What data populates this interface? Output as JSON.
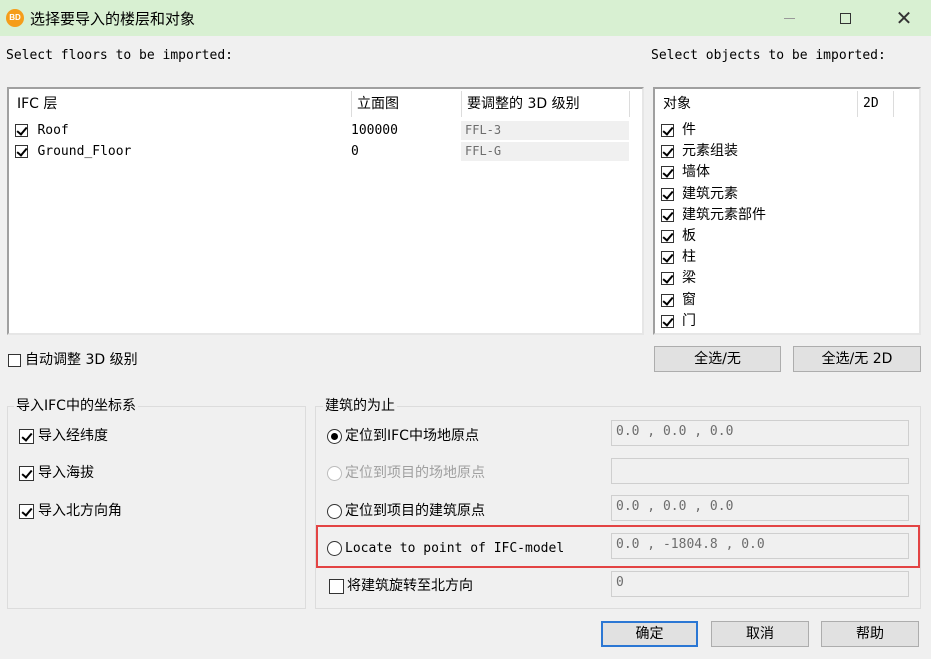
{
  "window": {
    "app_icon_text": "BD",
    "title": "选择要导入的楼层和对象"
  },
  "floors": {
    "label": "Select floors to be imported:",
    "columns": [
      "IFC 层",
      "立面图",
      "要调整的 3D 级别"
    ],
    "rows": [
      {
        "checked": true,
        "name": "Roof",
        "elevation": "100000",
        "level": "FFL-3"
      },
      {
        "checked": true,
        "name": "Ground_Floor",
        "elevation": "0",
        "level": "FFL-G"
      }
    ]
  },
  "objects": {
    "label": "Select objects to be imported:",
    "columns": [
      "对象",
      "2D"
    ],
    "items": [
      {
        "checked": true,
        "name": "件"
      },
      {
        "checked": true,
        "name": "元素组装"
      },
      {
        "checked": true,
        "name": "墙体"
      },
      {
        "checked": true,
        "name": "建筑元素"
      },
      {
        "checked": true,
        "name": "建筑元素部件"
      },
      {
        "checked": true,
        "name": "板"
      },
      {
        "checked": true,
        "name": "柱"
      },
      {
        "checked": true,
        "name": "梁"
      },
      {
        "checked": true,
        "name": "窗"
      },
      {
        "checked": true,
        "name": "门"
      }
    ]
  },
  "auto_adjust": {
    "checked": false,
    "label": "自动调整 3D 级别"
  },
  "buttons": {
    "select_all": "全选/无",
    "select_all_2d": "全选/无 2D",
    "ok": "确定",
    "cancel": "取消",
    "help": "帮助"
  },
  "coordinate_group": {
    "title": "导入IFC中的坐标系",
    "options": [
      {
        "checked": true,
        "label": "导入经纬度"
      },
      {
        "checked": true,
        "label": "导入海拔"
      },
      {
        "checked": true,
        "label": "导入北方向角"
      }
    ]
  },
  "building_group": {
    "title": "建筑的为止",
    "options": [
      {
        "selected": true,
        "disabled": false,
        "label": "定位到IFC中场地原点",
        "value": "0.0 , 0.0 , 0.0"
      },
      {
        "selected": false,
        "disabled": true,
        "label": "定位到项目的场地原点",
        "value": ""
      },
      {
        "selected": false,
        "disabled": false,
        "label": "定位到项目的建筑原点",
        "value": "0.0 , 0.0 , 0.0"
      },
      {
        "selected": false,
        "disabled": false,
        "label": "Locate to point of IFC-model",
        "value": "0.0 , -1804.8 , 0.0"
      }
    ],
    "rotate": {
      "checked": false,
      "label": "将建筑旋转至北方向",
      "value": "0"
    }
  },
  "colors": {
    "titlebar": "#d8f0d2",
    "highlight": "#e34444",
    "primary_border": "#2b77d4"
  }
}
